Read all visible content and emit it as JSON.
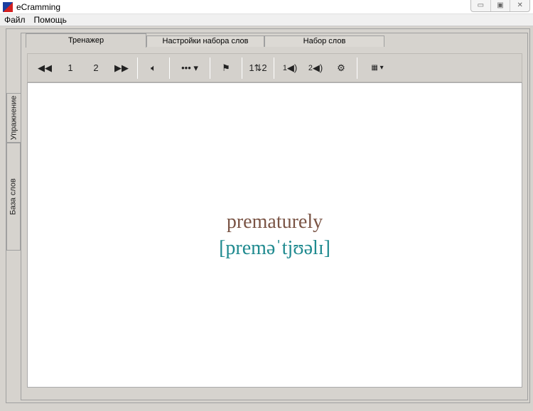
{
  "window": {
    "title": "eCramming"
  },
  "menu": [
    "Файл",
    "Помощь"
  ],
  "side_tabs": [
    "Упражнение",
    "База слов"
  ],
  "tabs": [
    "Тренажер",
    "Настройки набора слов",
    "Набор слов"
  ],
  "toolbar": {
    "first": "1",
    "second": "2",
    "more": "•••"
  },
  "card": {
    "word": "prematurely",
    "transcription": "[preməˈtjʊəlɪ]"
  }
}
